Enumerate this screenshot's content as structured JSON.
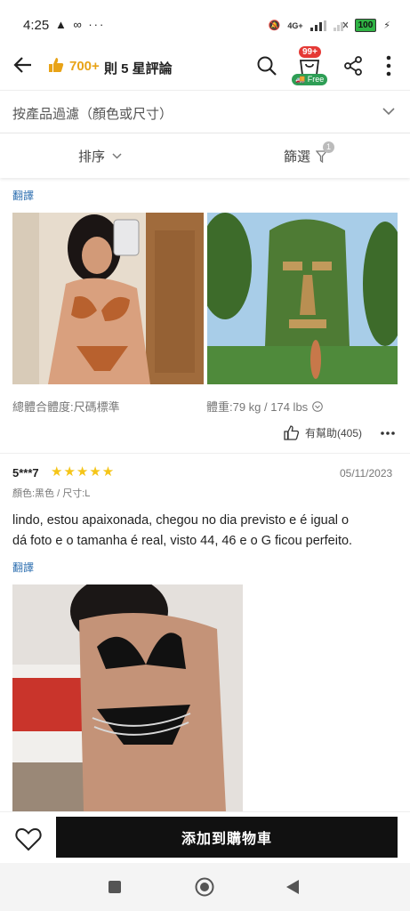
{
  "status": {
    "time": "4:25",
    "icons": "▲ ∞ ···",
    "network": "4G+",
    "battery": "100"
  },
  "header": {
    "rating_count": "700+",
    "rating_text": "則 5 星評論",
    "cart_badge": "99+",
    "free_label": "Free"
  },
  "filter": {
    "placeholder": "按產品過濾（顏色或尺寸）"
  },
  "sort": {
    "sort_label": "排序",
    "filter_label": "篩選",
    "filter_badge": "1"
  },
  "review1": {
    "translate": "翻譯",
    "fit": "總體合體度:尺碼標準",
    "weight": "體重:79 kg / 174 lbs",
    "helpful": "有幫助(405)"
  },
  "review2": {
    "user": "5***7",
    "stars": "★★★★★",
    "date": "05/11/2023",
    "meta": "顏色:黑色 / 尺寸:L",
    "body_line1": "lindo, estou apaixonada,  chegou no dia previsto e é igual o",
    "body_line2": "dá foto e o tamanha é real, visto 44, 46 e o G ficou perfeito.",
    "translate": "翻譯"
  },
  "bottom": {
    "add_to_cart": "添加到購物車"
  },
  "colors": {
    "accent_gold": "#f5c518",
    "link": "#2e6fb0",
    "cart_badge": "#e53935",
    "free_green": "#2e9e55"
  }
}
